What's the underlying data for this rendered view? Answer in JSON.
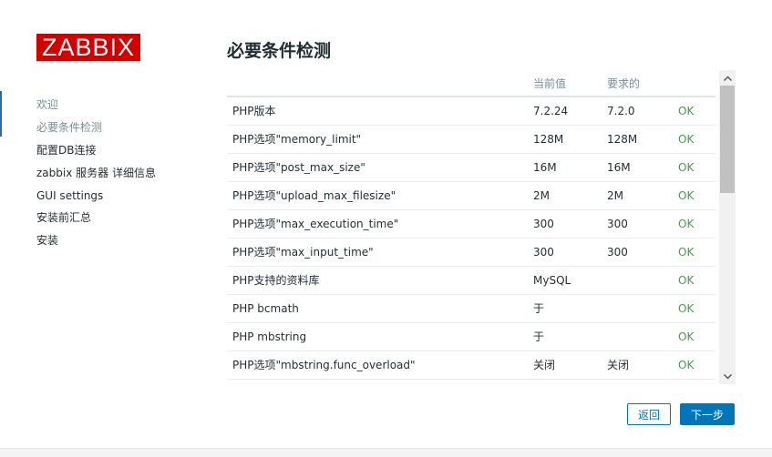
{
  "logo": {
    "text": "ZABBIX"
  },
  "nav": {
    "items": [
      {
        "label": "欢迎"
      },
      {
        "label": "必要条件检测"
      },
      {
        "label": "配置DB连接"
      },
      {
        "label": "zabbix 服务器 详细信息"
      },
      {
        "label": "GUI settings"
      },
      {
        "label": "安装前汇总"
      },
      {
        "label": "安装"
      }
    ]
  },
  "page": {
    "title": "必要条件检测"
  },
  "table": {
    "headers": {
      "name": "",
      "current": "当前值",
      "required": "要求的",
      "status": ""
    },
    "rows": [
      {
        "name": "PHP版本",
        "current": "7.2.24",
        "required": "7.2.0",
        "status": "OK"
      },
      {
        "name": "PHP选项\"memory_limit\"",
        "current": "128M",
        "required": "128M",
        "status": "OK"
      },
      {
        "name": "PHP选项\"post_max_size\"",
        "current": "16M",
        "required": "16M",
        "status": "OK"
      },
      {
        "name": "PHP选项\"upload_max_filesize\"",
        "current": "2M",
        "required": "2M",
        "status": "OK"
      },
      {
        "name": "PHP选项\"max_execution_time\"",
        "current": "300",
        "required": "300",
        "status": "OK"
      },
      {
        "name": "PHP选项\"max_input_time\"",
        "current": "300",
        "required": "300",
        "status": "OK"
      },
      {
        "name": "PHP支持的资料库",
        "current": "MySQL",
        "required": "",
        "status": "OK"
      },
      {
        "name": "PHP bcmath",
        "current": "于",
        "required": "",
        "status": "OK"
      },
      {
        "name": "PHP mbstring",
        "current": "于",
        "required": "",
        "status": "OK"
      },
      {
        "name": "PHP选项\"mbstring.func_overload\"",
        "current": "关闭",
        "required": "关闭",
        "status": "OK"
      }
    ]
  },
  "buttons": {
    "back": "返回",
    "next": "下一步"
  },
  "colors": {
    "brand": "#d40000",
    "accent": "#0275b8",
    "ok": "#429e47"
  },
  "icons": {
    "scroll_up": "chevron-up-icon",
    "scroll_down": "chevron-down-icon"
  }
}
